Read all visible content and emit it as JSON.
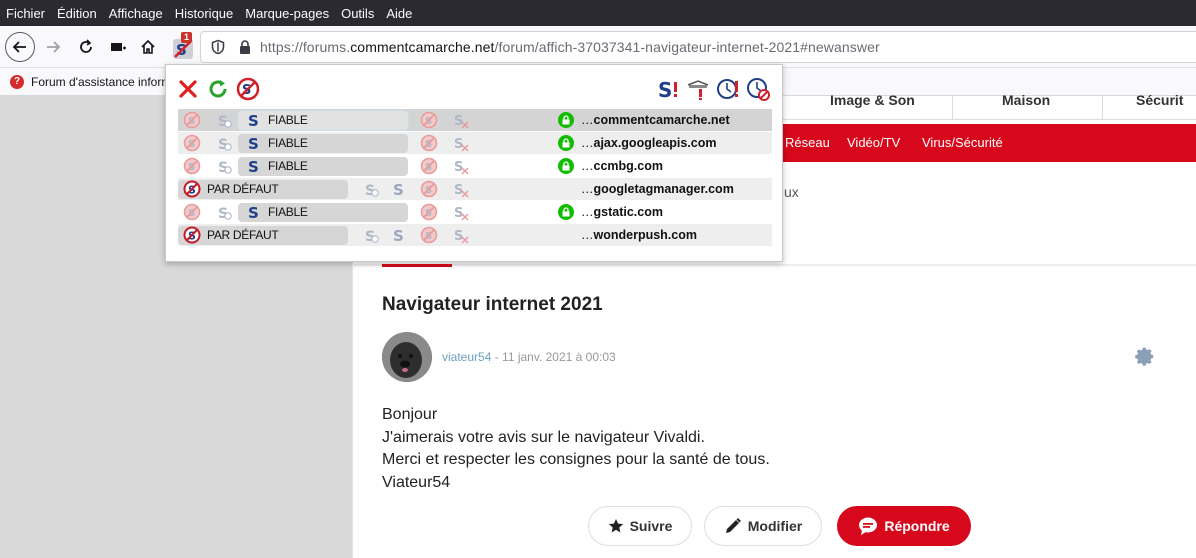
{
  "menu": {
    "items": [
      "Fichier",
      "Édition",
      "Affichage",
      "Historique",
      "Marque-pages",
      "Outils",
      "Aide"
    ]
  },
  "toolbar": {
    "url_prefix": "https://forums.",
    "url_host": "commentcamarche.net",
    "url_path": "/forum/affich-37037341-navigateur-internet-2021#newanswer",
    "extension_badge": "1"
  },
  "bookmarks": {
    "item": "Forum d'assistance inform"
  },
  "page": {
    "categories": [
      "Image & Son",
      "Maison",
      "Sécurit"
    ],
    "red_nav": [
      "Réseau",
      "Vidéo/TV",
      "Virus/Sécurité"
    ],
    "crumb_fragment": "ux",
    "post": {
      "title": "Navigateur internet 2021",
      "author": "viateur54",
      "date": " - 11 janv. 2021 à 00:03",
      "lines": [
        "Bonjour",
        "J'aimerais votre avis sur le navigateur Vivaldi.",
        "Merci et respecter les consignes pour la santé de tous.",
        "Viateur54"
      ]
    },
    "buttons": {
      "follow": "Suivre",
      "edit": "Modifier",
      "reply": "Répondre"
    }
  },
  "noscript": {
    "rows": [
      {
        "level": "FIABLE",
        "domain_prefix": "…",
        "domain": "commentcamarche.net",
        "secure": true,
        "trusted": true
      },
      {
        "level": "FIABLE",
        "domain_prefix": "…",
        "domain": "ajax.googleapis.com",
        "secure": true,
        "trusted": true
      },
      {
        "level": "FIABLE",
        "domain_prefix": "…",
        "domain": "ccmbg.com",
        "secure": true,
        "trusted": true
      },
      {
        "level": "PAR DÉFAUT",
        "domain_prefix": "…",
        "domain": "googletagmanager.com",
        "secure": false,
        "trusted": false
      },
      {
        "level": "FIABLE",
        "domain_prefix": "…",
        "domain": "gstatic.com",
        "secure": true,
        "trusted": true
      },
      {
        "level": "PAR DÉFAUT",
        "domain_prefix": "…",
        "domain": "wonderpush.com",
        "secure": false,
        "trusted": false
      }
    ],
    "colors": {
      "close": "#e02020",
      "reload": "#2ba32b",
      "lock": "#12bc00",
      "brand_blue": "#1f3f8a",
      "brand_red": "#d0202a"
    }
  }
}
